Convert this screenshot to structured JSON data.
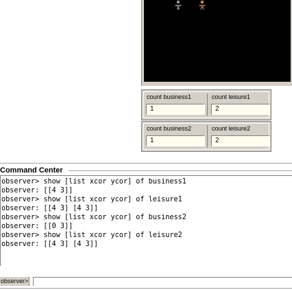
{
  "monitors": [
    {
      "label": "count business1",
      "value": "1"
    },
    {
      "label": "count leisure1",
      "value": "2"
    },
    {
      "label": "count business2",
      "value": "1"
    },
    {
      "label": "count leisure2",
      "value": "2"
    }
  ],
  "command_center": {
    "title": "Command Center",
    "output_lines": [
      "observer> show [list xcor ycor] of business1",
      "observer: [[4 3]]",
      "observer> show [list xcor ycor] of leisure1",
      "observer: [[4 3] [4 3]]",
      "observer> show [list xcor ycor] of business2",
      "observer: [[0 3]]",
      "observer> show [list xcor ycor] of leisure2",
      "observer: [[4 3] [4 3]]"
    ],
    "prompt_label": "observer>",
    "input_value": ""
  },
  "world": {
    "background": "#000000",
    "agent_icons": [
      "person-icon",
      "person-icon"
    ]
  }
}
